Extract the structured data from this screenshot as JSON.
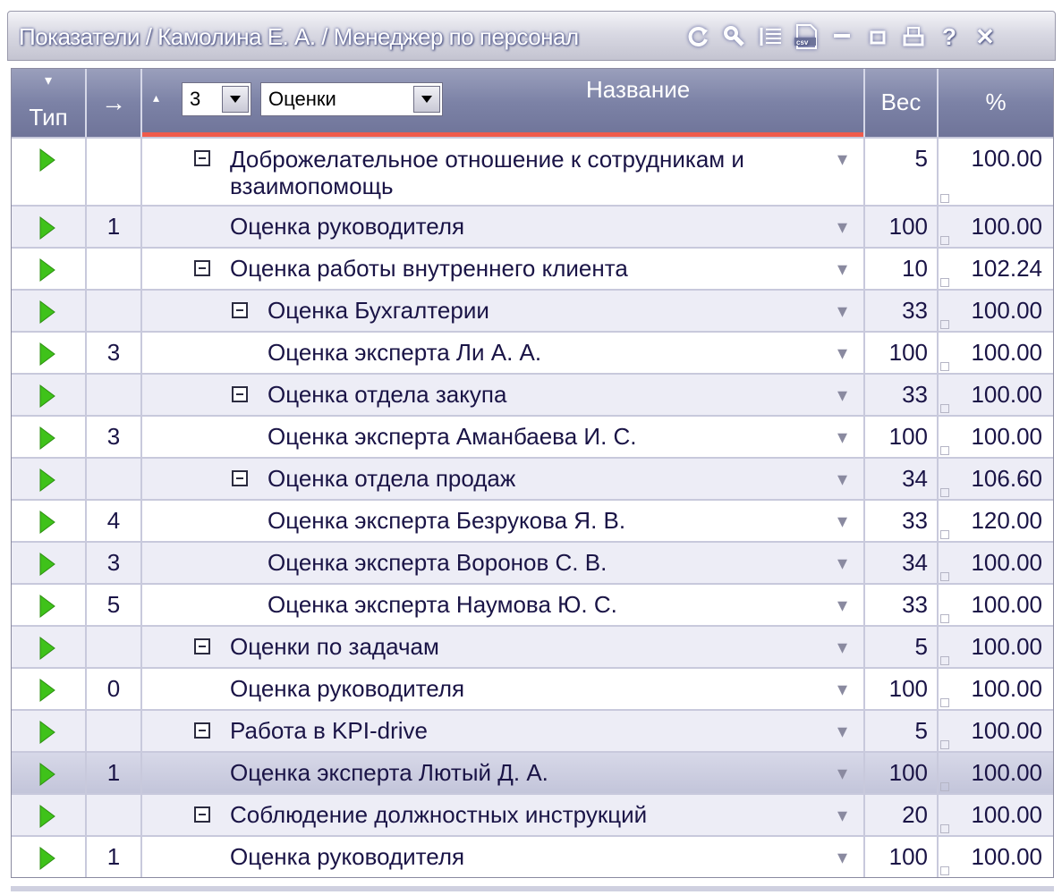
{
  "window": {
    "title": "Показатели / Камолина Е. А. / Менеджер по персонал",
    "toolbar_icons": [
      "refresh-icon",
      "search-icon",
      "list-icon",
      "csv-icon",
      "minimize-icon",
      "maximize-icon",
      "print-icon",
      "help-icon",
      "close-icon"
    ],
    "help_glyph": "?",
    "close_glyph": "✕"
  },
  "header": {
    "type_label": "Тип",
    "type_sort_glyph": "▾",
    "arrow_label": "→",
    "name_label": "Название",
    "name_sort_glyph": "▴",
    "level_value": "3",
    "kind_value": "Оценки",
    "weight_label": "Вес",
    "percent_label": "%"
  },
  "colors": {
    "header_bg": "#7c82a6",
    "accent_line": "#ef5b4c",
    "play_icon": "#3fc21a",
    "title_text": "#ffffff"
  },
  "rows": [
    {
      "num": "",
      "name": "Доброжелательное отношение к сотрудникам и взаимопомощь",
      "level": 1,
      "group": true,
      "weight": "5",
      "percent": "100.00"
    },
    {
      "num": "1",
      "name": "Оценка руководителя",
      "level": 1,
      "group": false,
      "weight": "100",
      "percent": "100.00"
    },
    {
      "num": "",
      "name": "Оценка работы внутреннего клиента",
      "level": 1,
      "group": true,
      "weight": "10",
      "percent": "102.24"
    },
    {
      "num": "",
      "name": "Оценка Бухгалтерии",
      "level": 2,
      "group": true,
      "weight": "33",
      "percent": "100.00"
    },
    {
      "num": "3",
      "name": "Оценка эксперта Ли А. А.",
      "level": 2,
      "group": false,
      "weight": "100",
      "percent": "100.00"
    },
    {
      "num": "",
      "name": "Оценка отдела закупа",
      "level": 2,
      "group": true,
      "weight": "33",
      "percent": "100.00"
    },
    {
      "num": "3",
      "name": "Оценка эксперта Аманбаева И. С.",
      "level": 2,
      "group": false,
      "weight": "100",
      "percent": "100.00"
    },
    {
      "num": "",
      "name": "Оценка отдела продаж",
      "level": 2,
      "group": true,
      "weight": "34",
      "percent": "106.60"
    },
    {
      "num": "4",
      "name": "Оценка эксперта Безрукова Я. В.",
      "level": 2,
      "group": false,
      "weight": "33",
      "percent": "120.00"
    },
    {
      "num": "3",
      "name": "Оценка эксперта Воронов С. В.",
      "level": 2,
      "group": false,
      "weight": "34",
      "percent": "100.00"
    },
    {
      "num": "5",
      "name": "Оценка эксперта Наумова Ю. С.",
      "level": 2,
      "group": false,
      "weight": "33",
      "percent": "100.00"
    },
    {
      "num": "",
      "name": "Оценки по задачам",
      "level": 1,
      "group": true,
      "weight": "5",
      "percent": "100.00"
    },
    {
      "num": "0",
      "name": "Оценка руководителя",
      "level": 1,
      "group": false,
      "weight": "100",
      "percent": "100.00"
    },
    {
      "num": "",
      "name": "Работа в KPI-drive",
      "level": 1,
      "group": true,
      "weight": "5",
      "percent": "100.00"
    },
    {
      "num": "1",
      "name": "Оценка эксперта Лютый Д. А.",
      "level": 1,
      "group": false,
      "weight": "100",
      "percent": "100.00",
      "selected": true
    },
    {
      "num": "",
      "name": "Соблюдение должностных инструкций",
      "level": 1,
      "group": true,
      "weight": "20",
      "percent": "100.00"
    },
    {
      "num": "1",
      "name": "Оценка руководителя",
      "level": 1,
      "group": false,
      "weight": "100",
      "percent": "100.00"
    }
  ]
}
